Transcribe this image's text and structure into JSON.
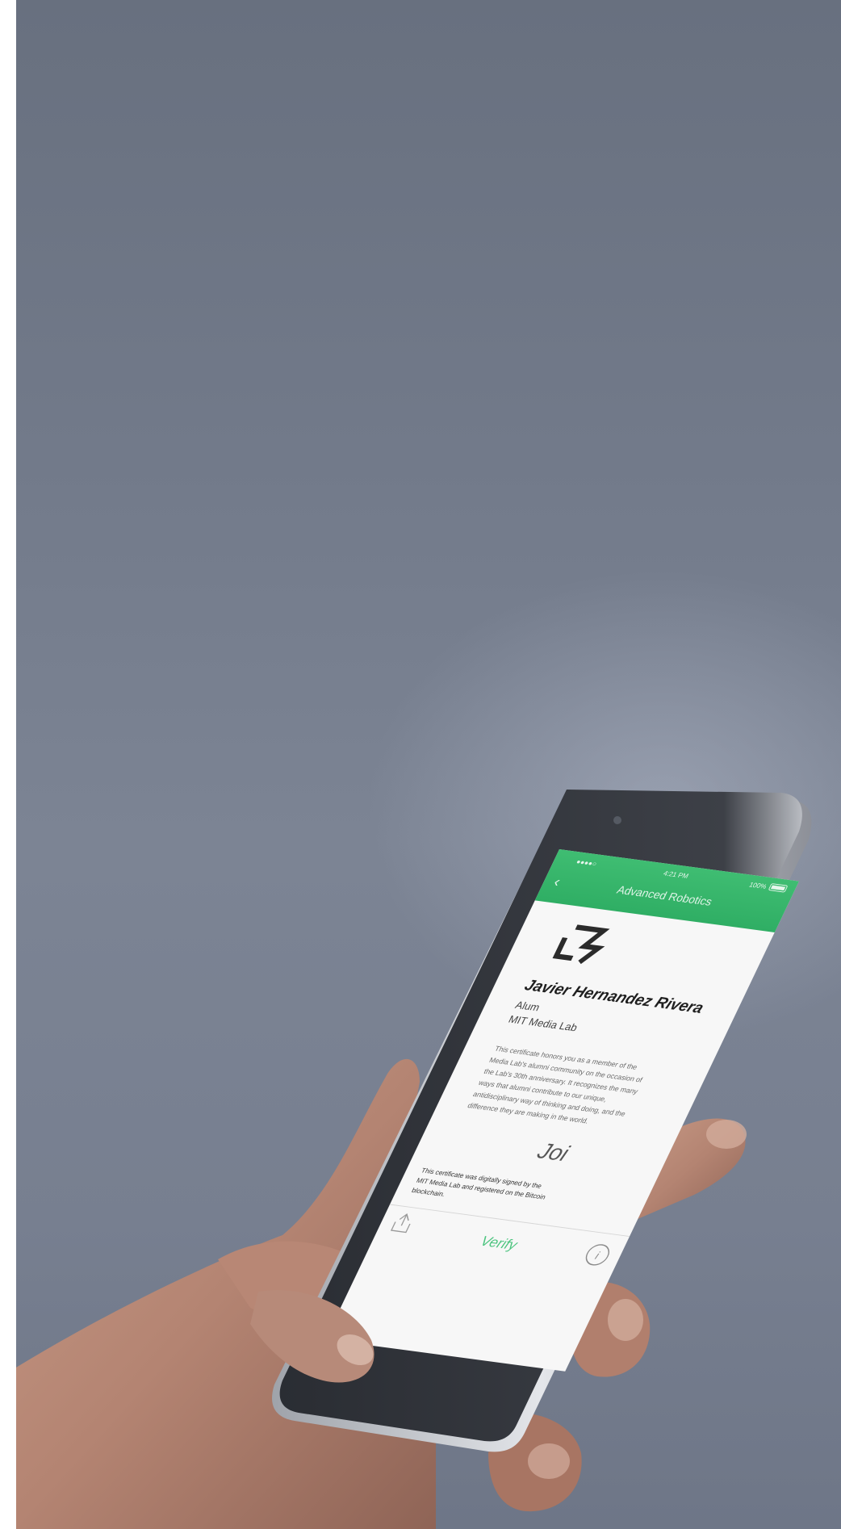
{
  "status_bar": {
    "time": "4:21 PM",
    "battery": "100%"
  },
  "nav_bar": {
    "title": "Advanced Robotics",
    "accent_color": "#33b56b"
  },
  "certificate": {
    "logo": "mit-media-lab-logo",
    "recipient_name": "Javier Hernandez Rivera",
    "role": "Alum",
    "organization": "MIT Media Lab",
    "description_lines": [
      "This certificate honors you as a member of the",
      "Media Lab's alumni community on the occasion of",
      "the Lab's 30th anniversary. It recognizes the many",
      "ways that alumni contribute to our unique,",
      "antidisciplinary way of thinking and doing, and the",
      "difference they are making in the world."
    ],
    "signature": "Joi",
    "blockchain_note_lines": [
      "This certificate was digitally signed by the",
      "MIT Media Lab and registered on the Bitcoin",
      "blockchain."
    ]
  },
  "toolbar": {
    "verify_label": "Verify",
    "share_icon": "share-icon",
    "info_icon": "info-icon"
  }
}
